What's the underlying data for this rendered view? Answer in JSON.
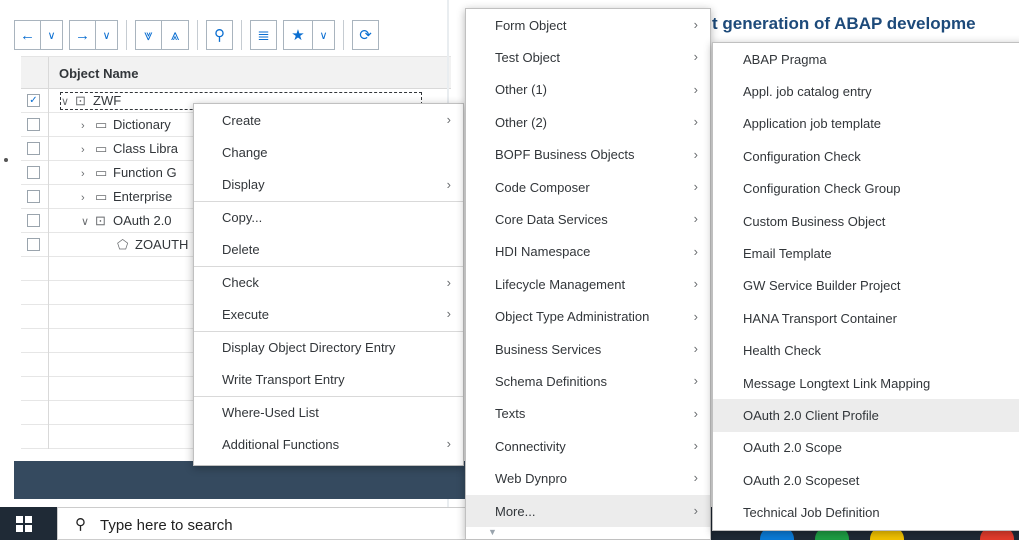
{
  "toolbar": {
    "icons": [
      "arrow-left-icon",
      "chevron-down-icon",
      "arrow-right-icon",
      "chevron-down-icon",
      "collapse-all-icon",
      "expand-all-icon",
      "search-icon",
      "hierarchy-icon",
      "star-icon",
      "chevron-down-icon",
      "refresh-icon"
    ]
  },
  "tree": {
    "column_header": "Object Name",
    "rows": [
      {
        "label": "ZWF",
        "checked": "✓"
      },
      {
        "label": "Dictionary"
      },
      {
        "label": "Class Libra"
      },
      {
        "label": "Function G"
      },
      {
        "label": "Enterprise"
      },
      {
        "label": "OAuth 2.0"
      },
      {
        "label": "ZOAUTH"
      }
    ]
  },
  "background": {
    "title_fragment": "t generation of ABAP developme"
  },
  "context_menu": {
    "items": [
      {
        "label": "Create"
      },
      {
        "label": "Change"
      },
      {
        "label": "Display"
      },
      {
        "label": "Copy..."
      },
      {
        "label": "Delete"
      },
      {
        "label": "Check"
      },
      {
        "label": "Execute"
      },
      {
        "label": "Display Object Directory Entry"
      },
      {
        "label": "Write Transport Entry"
      },
      {
        "label": "Where-Used List"
      },
      {
        "label": "Additional Functions"
      }
    ]
  },
  "create_submenu": {
    "items": [
      {
        "label": "Form Object"
      },
      {
        "label": "Test Object"
      },
      {
        "label": "Other (1)"
      },
      {
        "label": "Other (2)"
      },
      {
        "label": "BOPF Business Objects"
      },
      {
        "label": "Code Composer"
      },
      {
        "label": "Core Data Services"
      },
      {
        "label": "HDI Namespace"
      },
      {
        "label": "Lifecycle Management"
      },
      {
        "label": "Object Type Administration"
      },
      {
        "label": "Business Services"
      },
      {
        "label": "Schema Definitions"
      },
      {
        "label": "Texts"
      },
      {
        "label": "Connectivity"
      },
      {
        "label": "Web Dynpro"
      },
      {
        "label": "More..."
      }
    ]
  },
  "more_submenu": {
    "items": [
      {
        "label": "ABAP Pragma"
      },
      {
        "label": "Appl. job catalog entry"
      },
      {
        "label": "Application job template"
      },
      {
        "label": "Configuration Check"
      },
      {
        "label": "Configuration Check Group"
      },
      {
        "label": "Custom Business Object"
      },
      {
        "label": "Email Template"
      },
      {
        "label": "GW Service Builder Project"
      },
      {
        "label": "HANA Transport Container"
      },
      {
        "label": "Health Check"
      },
      {
        "label": "Message Longtext Link Mapping"
      },
      {
        "label": "OAuth 2.0 Client Profile"
      },
      {
        "label": "OAuth 2.0 Scope"
      },
      {
        "label": "OAuth 2.0 Scopeset"
      },
      {
        "label": "Technical Job Definition"
      }
    ]
  },
  "taskbar": {
    "search_placeholder": "Type here to search",
    "taskbar_colors": [
      "#0a7bd8",
      "#1e9e44",
      "#f2c200",
      "#e43c2c"
    ]
  }
}
